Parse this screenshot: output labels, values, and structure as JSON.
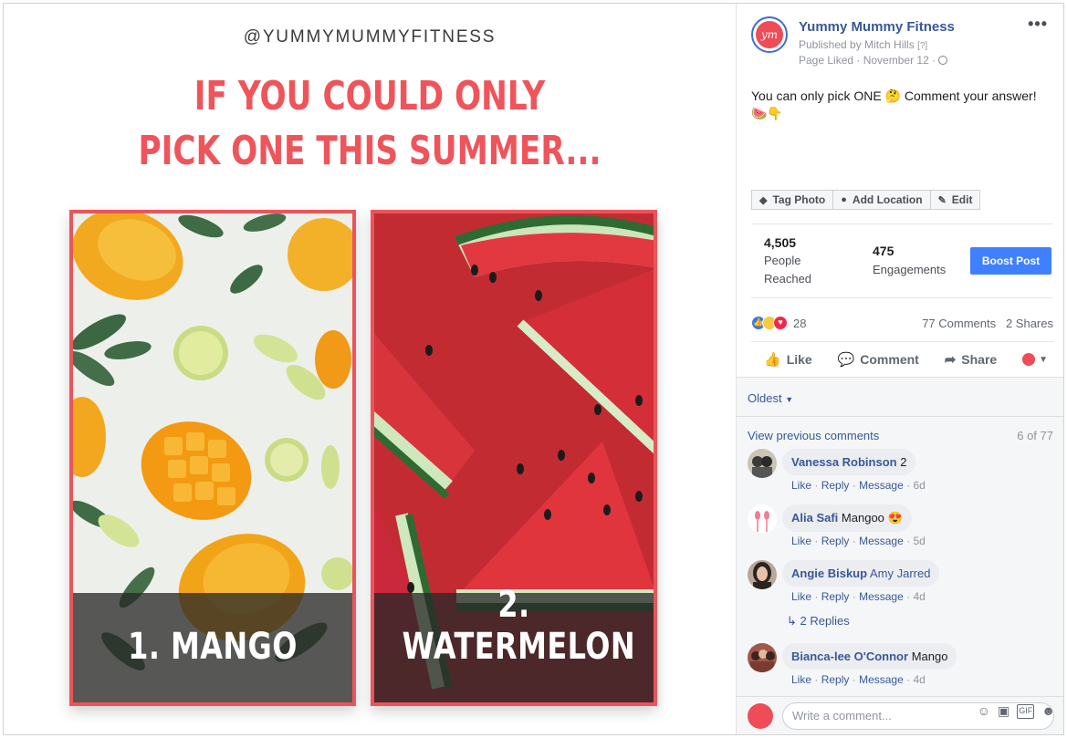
{
  "photo": {
    "handle": "@YUMMYMUMMYFITNESS",
    "headline_line1": "IF YOU COULD ONLY",
    "headline_line2": "PICK ONE THIS SUMMER...",
    "option1": "1. MANGO",
    "option2": "2. WATERMELON",
    "accent_color": "#f0545b"
  },
  "post": {
    "page_name": "Yummy Mummy Fitness",
    "avatar_text": "ym",
    "published_by": "Published by Mitch Hills",
    "published_help": "[?]",
    "page_liked": "Page Liked · November 12 ·",
    "more": "•••",
    "caption": "You can only pick ONE 🤔 Comment your answer!",
    "caption_emoji": "🍉👇"
  },
  "actions": {
    "tag_photo": "Tag Photo",
    "add_location": "Add Location",
    "edit": "Edit"
  },
  "insights": {
    "reached_num": "4,505",
    "reached_label1": "People",
    "reached_label2": "Reached",
    "engagements_num": "475",
    "engagements_label": "Engagements",
    "boost": "Boost Post"
  },
  "reactions": {
    "count": "28",
    "comments": "77 Comments",
    "shares": "2 Shares"
  },
  "buttons": {
    "like": "Like",
    "comment": "Comment",
    "share": "Share"
  },
  "comments_panel": {
    "sort": "Oldest",
    "view_previous": "View previous comments",
    "count": "6 of 77",
    "items": [
      {
        "name": "Vanessa Robinson",
        "text": "2",
        "like": "Like",
        "reply": "Reply",
        "message": "Message",
        "time": "6d"
      },
      {
        "name": "Alia Safi",
        "text": "Mangoo 😍",
        "like": "Like",
        "reply": "Reply",
        "message": "Message",
        "time": "5d"
      },
      {
        "name": "Angie Biskup",
        "text": "Amy Jarred",
        "like": "Like",
        "reply": "Reply",
        "message": "Message",
        "time": "4d"
      },
      {
        "name": "Bianca-lee O'Connor",
        "text": "Mango",
        "like": "Like",
        "reply": "Reply",
        "message": "Message",
        "time": "4d"
      }
    ],
    "replies": "2 Replies",
    "write_placeholder": "Write a comment..."
  }
}
